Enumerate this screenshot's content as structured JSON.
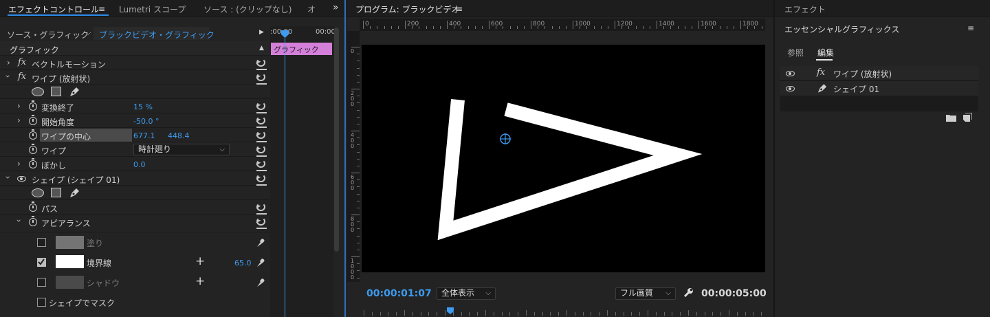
{
  "effect_controls": {
    "tabs": [
      {
        "label": "エフェクトコントロール",
        "active": true
      },
      {
        "label": "Lumetri スコープ",
        "active": false
      },
      {
        "label": "ソース : (クリップなし)",
        "active": false
      },
      {
        "label": "オ",
        "active": false
      }
    ],
    "source_label": "ソース・グラフィック",
    "clip_label": "ブラックビデオ・グラフィック",
    "timeline_start": ":00:00",
    "timeline_end": "00:00",
    "clip_bar_label": "グラフィック",
    "section_title": "グラフィック",
    "vector_motion": "ベクトルモーション",
    "wipe_effect": "ワイプ (放射状)",
    "transition_end_label": "変換終了",
    "transition_end_value": "15 %",
    "start_angle_label": "開始角度",
    "start_angle_value": "-50.0 °",
    "wipe_center_label": "ワイプの中心",
    "wipe_center_x": "677.1",
    "wipe_center_y": "448.4",
    "wipe_label": "ワイプ",
    "wipe_value": "時計廻り",
    "feather_label": "ぼかし",
    "feather_value": "0.0",
    "shape_layer": "シェイプ (シェイプ 01)",
    "path_label": "パス",
    "appearance_label": "アピアランス",
    "fill_label": "塗り",
    "stroke_label": "境界線",
    "stroke_value": "65.0",
    "shadow_label": "シャドウ",
    "mask_label": "シェイプでマスク"
  },
  "program": {
    "title": "プログラム: ブラックビデオ",
    "ruler_labels": [
      "0",
      "200",
      "400",
      "600",
      "800",
      "1000",
      "1200",
      "1400",
      "1600",
      "1800"
    ],
    "vruler_labels": [
      "0",
      "200",
      "400",
      "600",
      "800",
      "1000"
    ],
    "current_time": "00:00:01:07",
    "zoom": "全体表示",
    "quality": "フル画質",
    "duration": "00:00:05:00",
    "stroke_color": "#ffffff",
    "background_color": "#000000",
    "accent_color": "#3d9bf0"
  },
  "essential": {
    "panel_tab": "エフェクト",
    "title": "エッセンシャルグラフィックス",
    "tab_browse": "参照",
    "tab_edit": "編集",
    "layer1": "ワイプ (放射状)",
    "layer2": "シェイプ 01"
  }
}
